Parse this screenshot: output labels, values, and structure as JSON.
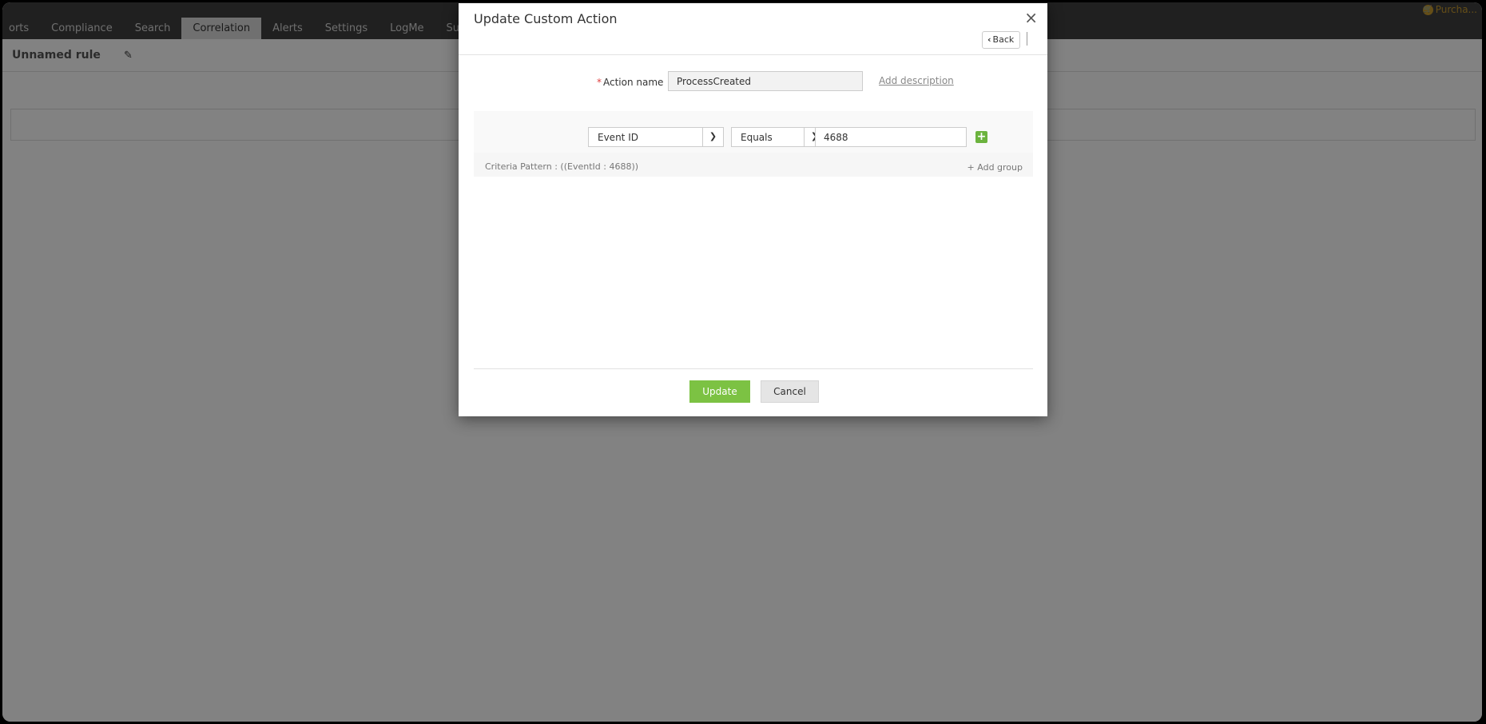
{
  "nav": {
    "tabs": [
      {
        "label": "orts"
      },
      {
        "label": "Compliance"
      },
      {
        "label": "Search"
      },
      {
        "label": "Correlation"
      },
      {
        "label": "Alerts"
      },
      {
        "label": "Settings"
      },
      {
        "label": "LogMe"
      },
      {
        "label": "Suppor"
      }
    ],
    "active_tab": "Correlation",
    "purchase_label": "Purcha..."
  },
  "rule": {
    "name": "Unnamed rule",
    "edit_icon": "pencil-icon"
  },
  "modal": {
    "title": "Update Custom Action",
    "close_glyph": "×",
    "back_label": "Back",
    "action_name_label": "Action name",
    "required_mark": "*",
    "action_name_value": "ProcessCreated",
    "add_description_label": "Add description",
    "criteria": {
      "field": "Event ID",
      "operator": "Equals",
      "value": "4688",
      "add_glyph": "+",
      "pattern_text": "Criteria Pattern : ((EventId : 4688))",
      "add_group_label": "Add group"
    },
    "update_label": "Update",
    "cancel_label": "Cancel"
  },
  "colors": {
    "topnav_bg": "#404040",
    "active_tab_bg": "#dcdcdc",
    "primary_green": "#7cc243",
    "purchase_gold": "#c79a2e"
  }
}
